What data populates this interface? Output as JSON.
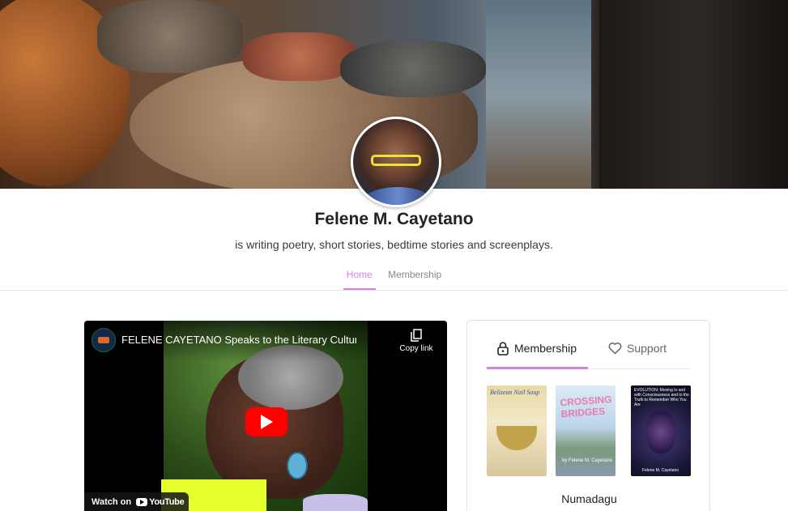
{
  "profile": {
    "name": "Felene M. Cayetano",
    "tagline": "is writing poetry, short stories, bedtime stories and screenplays."
  },
  "nav": {
    "tabs": [
      {
        "label": "Home",
        "active": true
      },
      {
        "label": "Membership",
        "active": false
      }
    ]
  },
  "video": {
    "title": "FELENE CAYETANO Speaks to the Literary Culture fro...",
    "copy_link_label": "Copy link",
    "watch_on_label": "Watch on",
    "youtube_label": "YouTube"
  },
  "membership_card": {
    "tabs": [
      {
        "label": "Membership",
        "icon": "lock-icon",
        "active": true
      },
      {
        "label": "Support",
        "icon": "heart-icon",
        "active": false
      }
    ],
    "books": [
      {
        "title": "Belizean Nail Soup"
      },
      {
        "title": "CROSSING BRIDGES",
        "author": "by Felene M. Cayetano"
      },
      {
        "title": "EVOLUTION: Moving to and with Consciousness and to the Truth to Remember Who You Are",
        "author": "Felene M. Cayetano"
      }
    ],
    "tier_name": "Numadagu"
  },
  "colors": {
    "accent": "#d97fe0",
    "youtube_red": "#ff0000"
  }
}
